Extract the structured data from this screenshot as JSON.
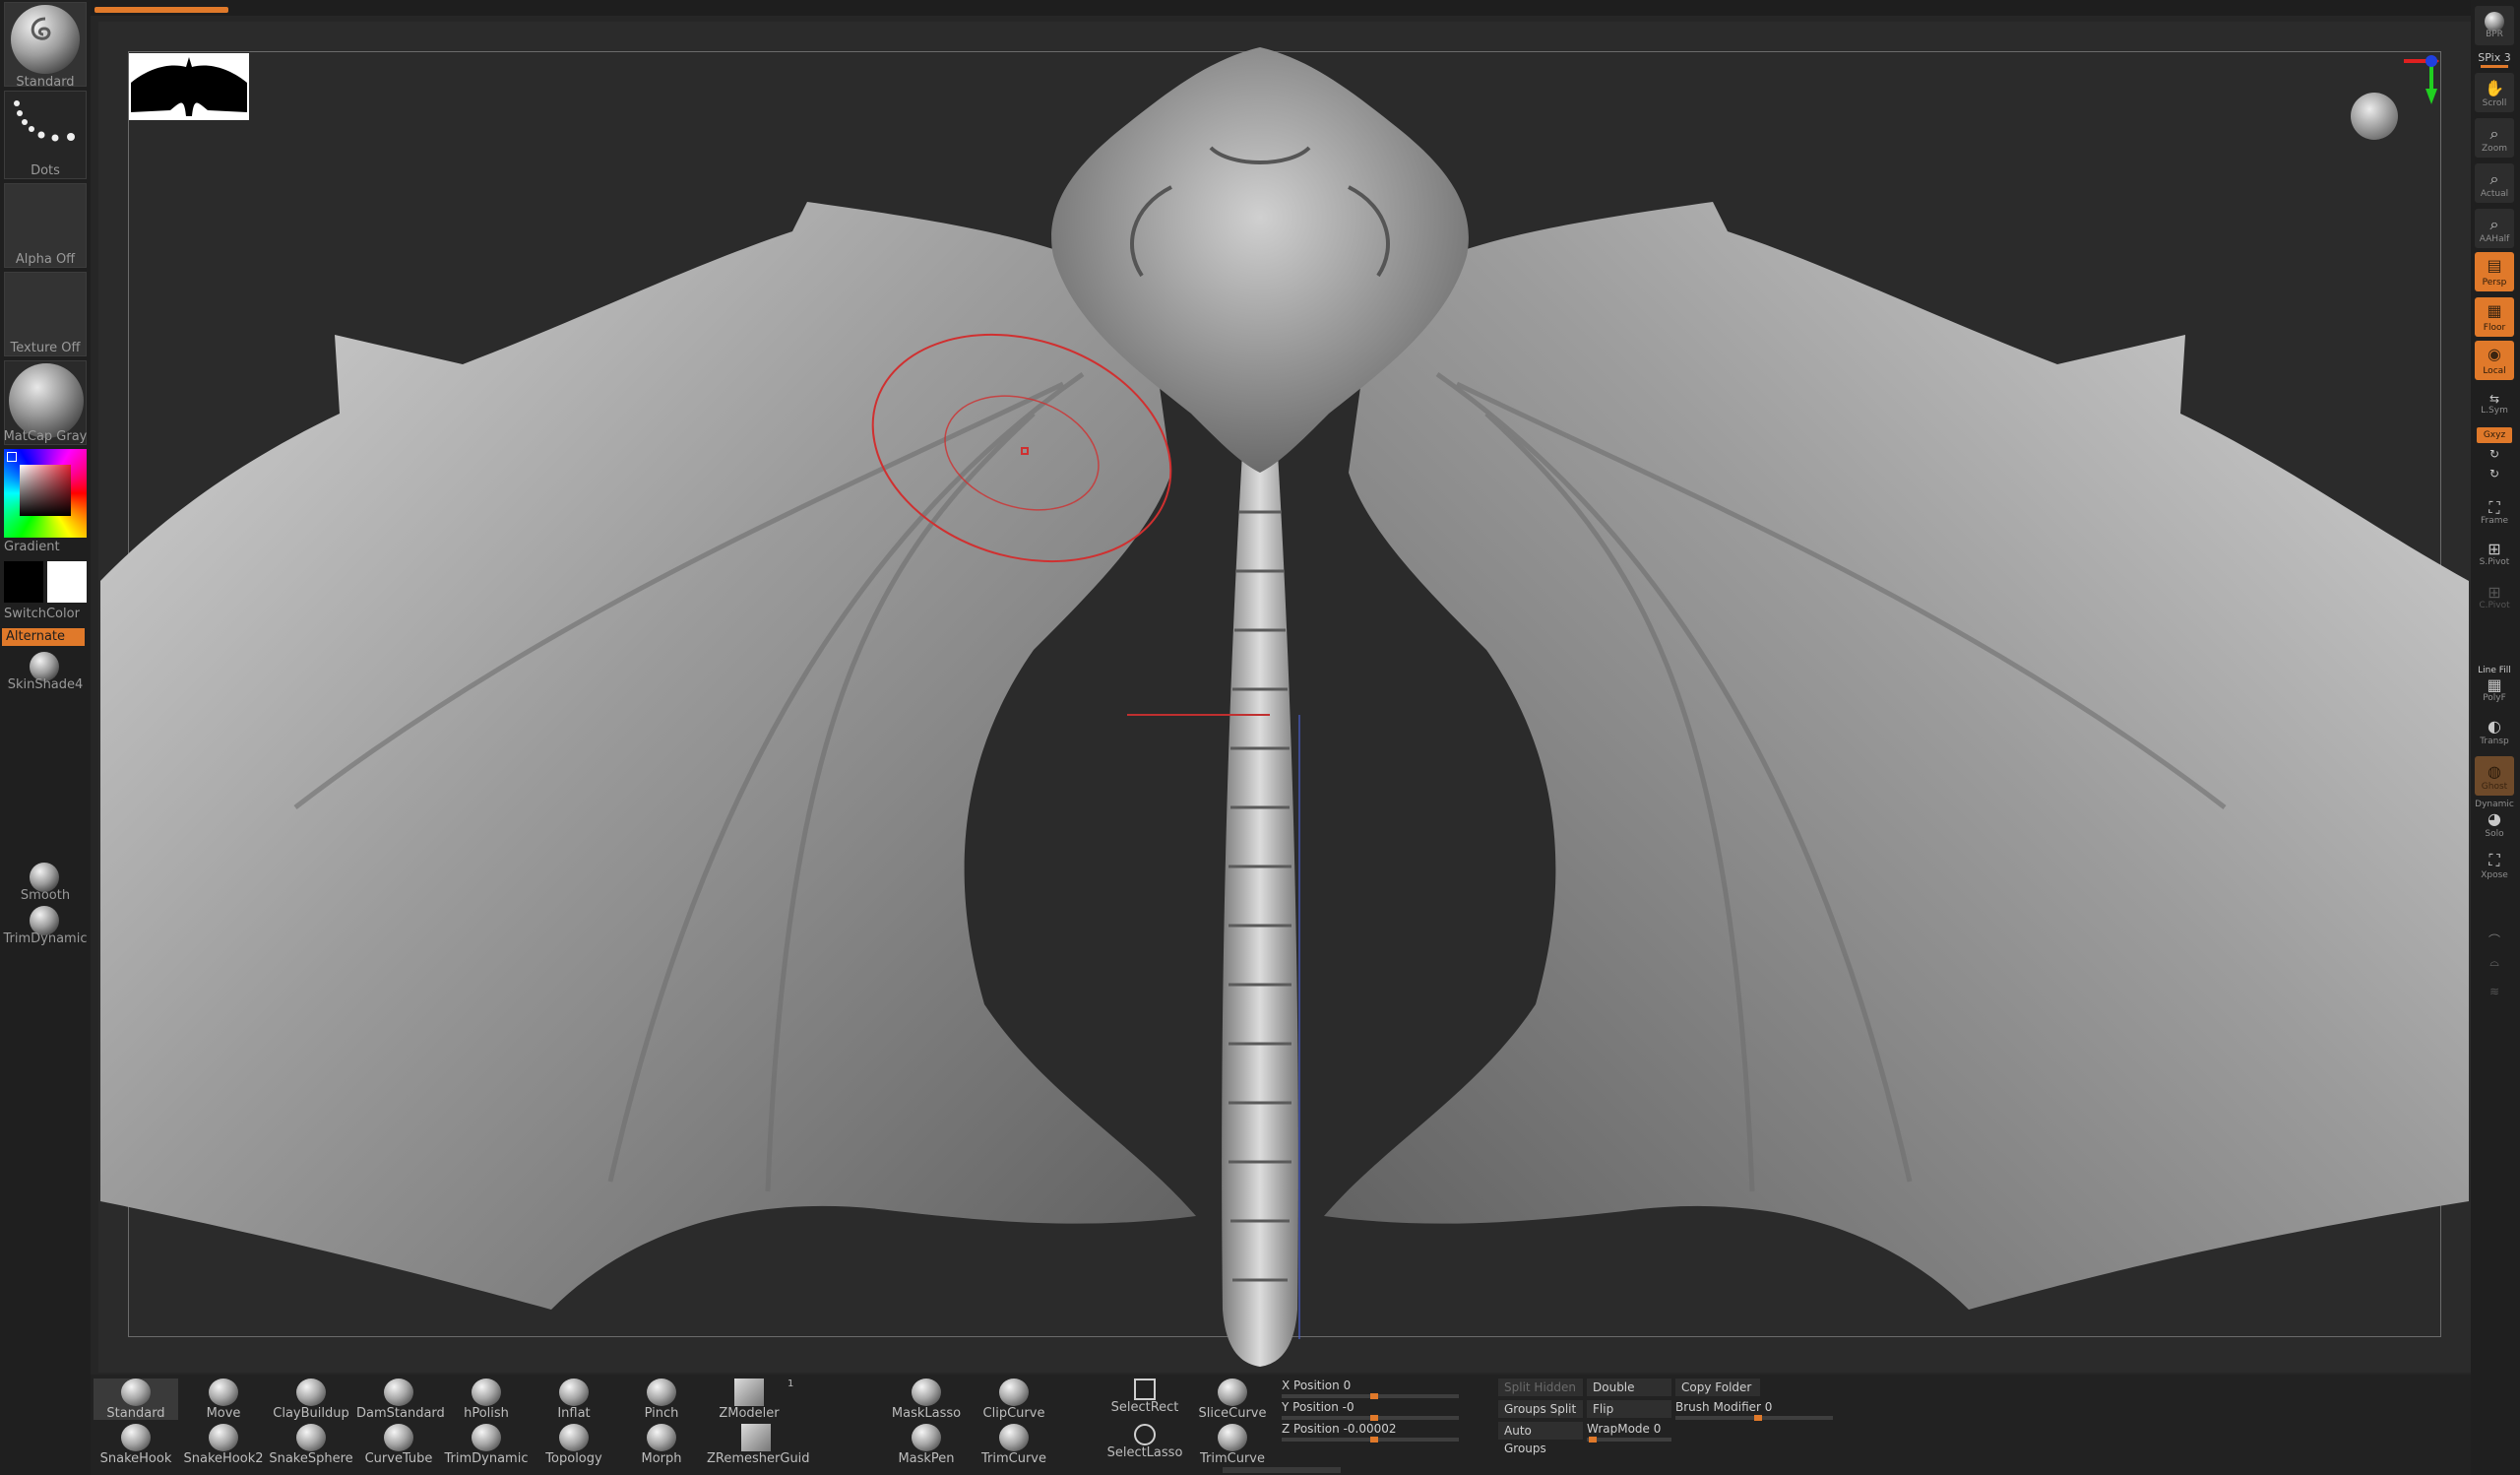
{
  "left_tray": {
    "brush_label": "Standard",
    "stroke_label": "Dots",
    "alpha_label": "Alpha Off",
    "texture_label": "Texture Off",
    "material_label": "MatCap Gray",
    "gradient_label": "Gradient",
    "switchcolor_label": "SwitchColor",
    "alternate_label": "Alternate",
    "skinshade_label": "SkinShade4",
    "smooth_label": "Smooth",
    "trimdynamic_label": "TrimDynamic"
  },
  "right_shelf": {
    "bpr_label": "BPR",
    "spix_label": "SPix 3",
    "scroll_label": "Scroll",
    "zoom_label": "Zoom",
    "actual_label": "Actual",
    "aahalf_label": "AAHalf",
    "persp_label": "Persp",
    "floor_label": "Floor",
    "local_label": "Local",
    "lsym_label": "L.Sym",
    "gxyz_label": "Gxyz",
    "frame_label": "Frame",
    "spf_label": "S.Pivot",
    "cpivot_label": "C.Pivot",
    "linefill_label": "Line Fill",
    "polyf_label": "PolyF",
    "transp_label": "Transp",
    "ghost_label": "Ghost",
    "dynamic_label": "Dynamic",
    "solo_label": "Solo",
    "xpose_label": "Xpose"
  },
  "bottom_shelf": {
    "row1": [
      "Standard",
      "Move",
      "ClayBuildup",
      "DamStandard",
      "hPolish",
      "Inflat",
      "Pinch",
      "ZModeler"
    ],
    "row2": [
      "SnakeHook",
      "SnakeHook2",
      "SnakeSphere",
      "CurveTube",
      "TrimDynamic",
      "Topology",
      "Morph",
      "ZRemesherGuid"
    ],
    "zmodeler_badge": "1",
    "mask": [
      "MaskLasso",
      "MaskPen"
    ],
    "clip": [
      "ClipCurve",
      "TrimCurve"
    ],
    "select": [
      "SelectRect",
      "SelectLasso"
    ],
    "slice": [
      "SliceCurve",
      "TrimCurve"
    ],
    "x_position": "X Position 0",
    "y_position": "Y Position -0",
    "z_position": "Z Position -0.00002",
    "split_hidden": "Split Hidden",
    "groups_split": "Groups Split",
    "auto_groups": "Auto Groups",
    "double": "Double",
    "flip": "Flip",
    "wrapmode": "WrapMode 0",
    "copy_folder": "Copy Folder",
    "brush_modifier": "Brush Modifier 0"
  },
  "colors": {
    "accent": "#e0792a",
    "panel": "#1f1f1f",
    "canvas": "#2b2b2b"
  },
  "progress_fraction": 0.054
}
